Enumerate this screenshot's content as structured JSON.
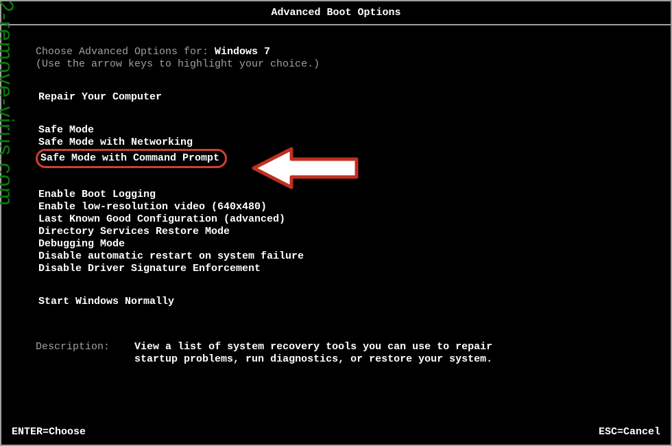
{
  "watermark": "2-remove-virus.com",
  "title": "Advanced Boot Options",
  "intro": {
    "prefix": "Choose Advanced Options for: ",
    "os": "Windows 7",
    "hint": "(Use the arrow keys to highlight your choice.)"
  },
  "menu": {
    "repair": "Repair Your Computer",
    "safe_modes": [
      "Safe Mode",
      "Safe Mode with Networking",
      "Safe Mode with Command Prompt"
    ],
    "options": [
      "Enable Boot Logging",
      "Enable low-resolution video (640x480)",
      "Last Known Good Configuration (advanced)",
      "Directory Services Restore Mode",
      "Debugging Mode",
      "Disable automatic restart on system failure",
      "Disable Driver Signature Enforcement"
    ],
    "normal": "Start Windows Normally"
  },
  "description": {
    "label": "Description:",
    "text_line1": "View a list of system recovery tools you can use to repair",
    "text_line2": "startup problems, run diagnostics, or restore your system."
  },
  "footer": {
    "enter": "ENTER=Choose",
    "esc": "ESC=Cancel"
  }
}
